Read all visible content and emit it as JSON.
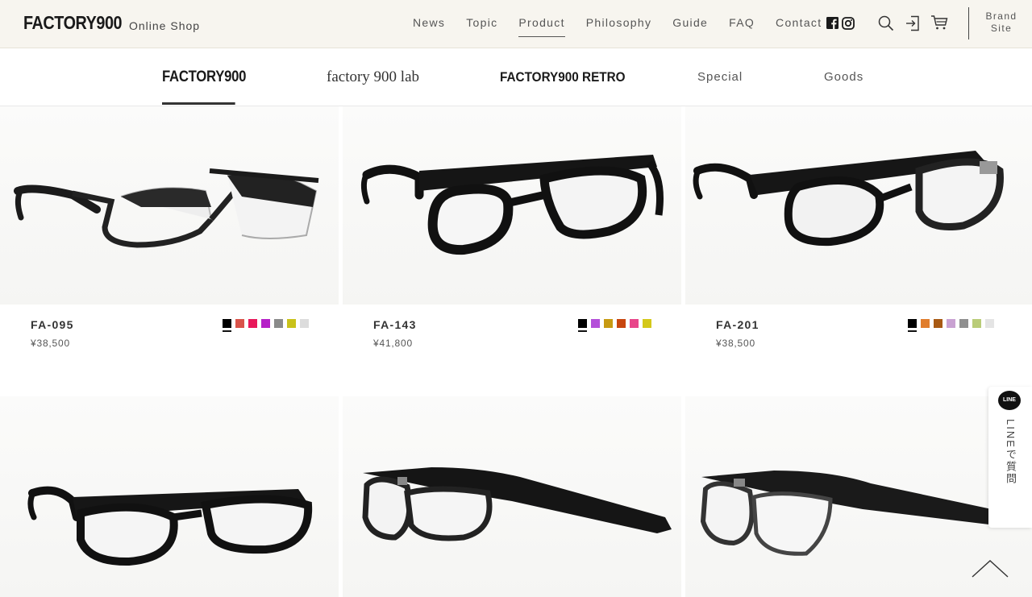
{
  "header": {
    "logo": "FACTORY900",
    "logo_sub": "Online Shop",
    "nav": [
      {
        "label": "News"
      },
      {
        "label": "Topic"
      },
      {
        "label": "Product",
        "active": true
      },
      {
        "label": "Philosophy"
      },
      {
        "label": "Guide"
      },
      {
        "label": "FAQ"
      },
      {
        "label": "Contact"
      }
    ],
    "icons": [
      "facebook-icon",
      "instagram-icon",
      "search-icon",
      "login-icon",
      "cart-icon"
    ],
    "brand_site_line1": "Brand",
    "brand_site_line2": "Site"
  },
  "subnav": {
    "items": [
      {
        "label": "FACTORY900",
        "active": true
      },
      {
        "label": "factory 900 lab"
      },
      {
        "label": "FACTORY900 RETRO"
      },
      {
        "label": "Special"
      },
      {
        "label": "Goods"
      }
    ]
  },
  "products": [
    {
      "name": "FA-095",
      "price": "¥38,500",
      "colors": [
        "#000000",
        "#d9534a",
        "#e8185a",
        "#b620c8",
        "#8a8a8a",
        "#c9c21a",
        "#dcdcdc"
      ]
    },
    {
      "name": "FA-143",
      "price": "¥41,800",
      "colors": [
        "#000000",
        "#b44fd9",
        "#c79a12",
        "#c8460e",
        "#e8468a",
        "#d4c81a"
      ]
    },
    {
      "name": "FA-201",
      "price": "¥38,500",
      "colors": [
        "#000000",
        "#e07d2c",
        "#a85a14",
        "#c9a2d2",
        "#8f8f8f",
        "#b9cc78",
        "#e4e4e4"
      ]
    },
    {
      "name": "",
      "price": "",
      "colors": []
    },
    {
      "name": "",
      "price": "",
      "colors": []
    },
    {
      "name": "",
      "price": "",
      "colors": []
    }
  ],
  "line_tab": {
    "bubble": "LINE",
    "text": "LINEで質問"
  },
  "colors": {
    "header_bg": "#f7f5ef",
    "text": "#333333",
    "accent": "#111111"
  }
}
